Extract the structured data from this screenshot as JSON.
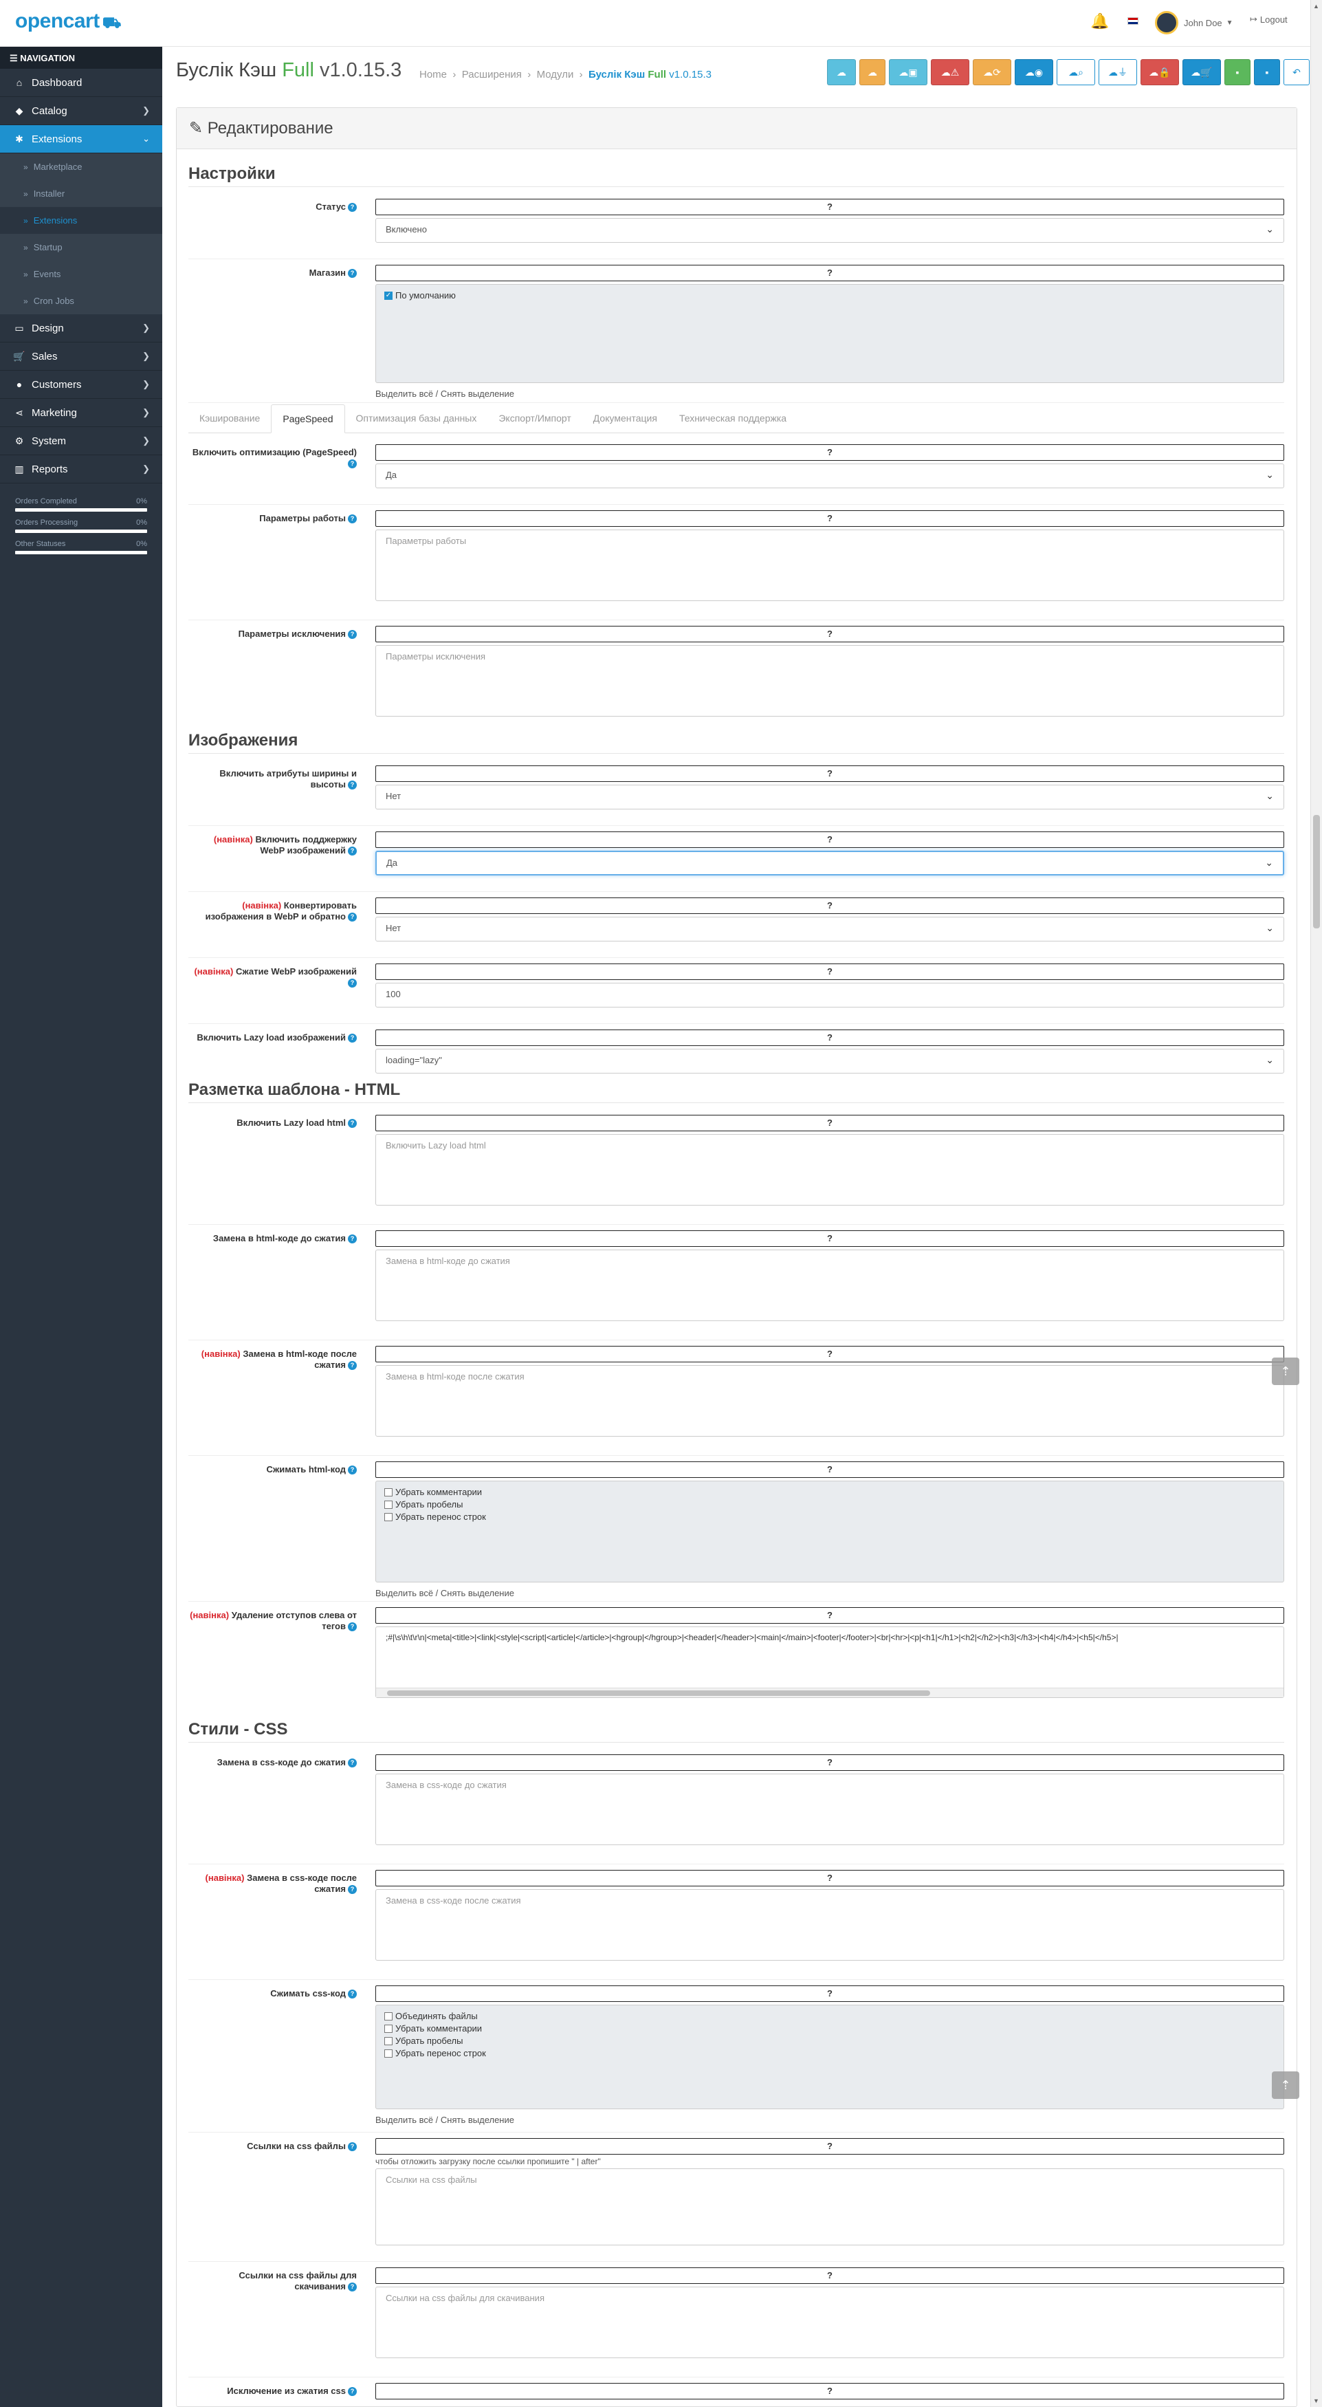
{
  "header": {
    "logo": "opencart",
    "user_name": "John Doe",
    "logout": "Logout"
  },
  "nav": {
    "title": "NAVIGATION",
    "items": [
      {
        "label": "Dashboard"
      },
      {
        "label": "Catalog"
      },
      {
        "label": "Extensions"
      },
      {
        "label": "Design"
      },
      {
        "label": "Sales"
      },
      {
        "label": "Customers"
      },
      {
        "label": "Marketing"
      },
      {
        "label": "System"
      },
      {
        "label": "Reports"
      }
    ],
    "sub_items": [
      {
        "label": "Marketplace"
      },
      {
        "label": "Installer"
      },
      {
        "label": "Extensions"
      },
      {
        "label": "Startup"
      },
      {
        "label": "Events"
      },
      {
        "label": "Cron Jobs"
      }
    ],
    "stats": [
      {
        "label": "Orders Completed",
        "value": "0%",
        "level": 0
      },
      {
        "label": "Orders Processing",
        "value": "0%",
        "level": 0
      },
      {
        "label": "Other Statuses",
        "value": "0%",
        "level": 0
      }
    ]
  },
  "page": {
    "title_a": "Буслік Кэш",
    "title_full": "Full",
    "title_ver": "v1.0.15.3",
    "breadcrumb": [
      "Home",
      "Расширения",
      "Модули"
    ],
    "breadcrumb_cur_a": "Буслік Кэш",
    "breadcrumb_cur_full": "Full",
    "breadcrumb_cur_ver": "v1.0.15.3",
    "panel_title": "Редактирование"
  },
  "toolbar_colors": [
    "#5bc0de",
    "#f0ad4e",
    "#5bc0de",
    "#d9534f",
    "#f0ad4e",
    "#1e91cf",
    "#ffffff",
    "#ffffff",
    "#d9534f",
    "#1e91cf",
    "#5cb85c",
    "#1e91cf",
    "#ffffff"
  ],
  "sections": {
    "settings": "Настройки",
    "images": "Изображения",
    "html": "Разметка шаблона - HTML",
    "css": "Стили - CSS"
  },
  "q": "?",
  "novinka": "(навінка)",
  "select_all": "Выделить всё / Снять выделение",
  "tabs": [
    "Кэширование",
    "PageSpeed",
    "Оптимизация базы данных",
    "Экспорт/Импорт",
    "Документация",
    "Техническая поддержка"
  ],
  "fields": {
    "status": {
      "label": "Статус",
      "value": "Включено"
    },
    "store": {
      "label": "Магазин",
      "option": "По умолчанию"
    },
    "pagespeed": {
      "label": "Включить оптимизацию (PageSpeed)",
      "value": "Да"
    },
    "params": {
      "label": "Параметры работы",
      "placeholder": "Параметры работы"
    },
    "params_exc": {
      "label": "Параметры исключения",
      "placeholder": "Параметры исключения"
    },
    "img_attr": {
      "label": "Включить атрибуты ширины и высоты",
      "value": "Нет"
    },
    "webp": {
      "label": "Включить подджержку WebP изображений",
      "value": "Да"
    },
    "webp_conv": {
      "label": "Конвертировать изображения в WebP и обратно",
      "value": "Нет"
    },
    "webp_q": {
      "label": "Сжатие WebP изображений",
      "value": "100"
    },
    "lazy_img": {
      "label": "Включить Lazy load изображений",
      "value": "loading=\"lazy\""
    },
    "lazy_html": {
      "label": "Включить Lazy load html",
      "placeholder": "Включить Lazy load html"
    },
    "html_before": {
      "label": "Замена в html-коде до сжатия",
      "placeholder": "Замена в html-коде до сжатия"
    },
    "html_after": {
      "label": "Замена в html-коде после сжатия",
      "placeholder": "Замена в html-коде после сжатия"
    },
    "html_min": {
      "label": "Сжимать html-код",
      "options": [
        "Убрать комментарии",
        "Убрать пробелы",
        "Убрать перенос строк"
      ]
    },
    "html_indent": {
      "label": "Удаление отступов слева от тегов",
      "value": ";#|\\s\\h\\t\\r\\n|<meta|<title>|<link|<style|<script|<article|</article>|<hgroup|</hgroup>|<header|</header>|<main|</main>|<footer|</footer>|<br|<hr>|<p|<h1|</h1>|<h2|</h2>|<h3|</h3>|<h4|</h4>|<h5|</h5>|"
    },
    "css_before": {
      "label": "Замена в css-коде до сжатия",
      "placeholder": "Замена в css-коде до сжатия"
    },
    "css_after": {
      "label": "Замена в css-коде после сжатия",
      "placeholder": "Замена в css-коде после сжатия"
    },
    "css_min": {
      "label": "Сжимать css-код",
      "options": [
        "Объединять файлы",
        "Убрать комментарии",
        "Убрать пробелы",
        "Убрать перенос строк"
      ]
    },
    "css_links": {
      "label": "Ссылки на css файлы",
      "hint": "чтобы отложить загрузку после ссылки пропишите \" | after\"",
      "placeholder": "Ссылки на css файлы"
    },
    "css_dl": {
      "label": "Ссылки на css файлы для скачивания",
      "placeholder": "Ссылки на css файлы для скачивания"
    },
    "css_exc": {
      "label": "Исключение из сжатия css"
    }
  }
}
